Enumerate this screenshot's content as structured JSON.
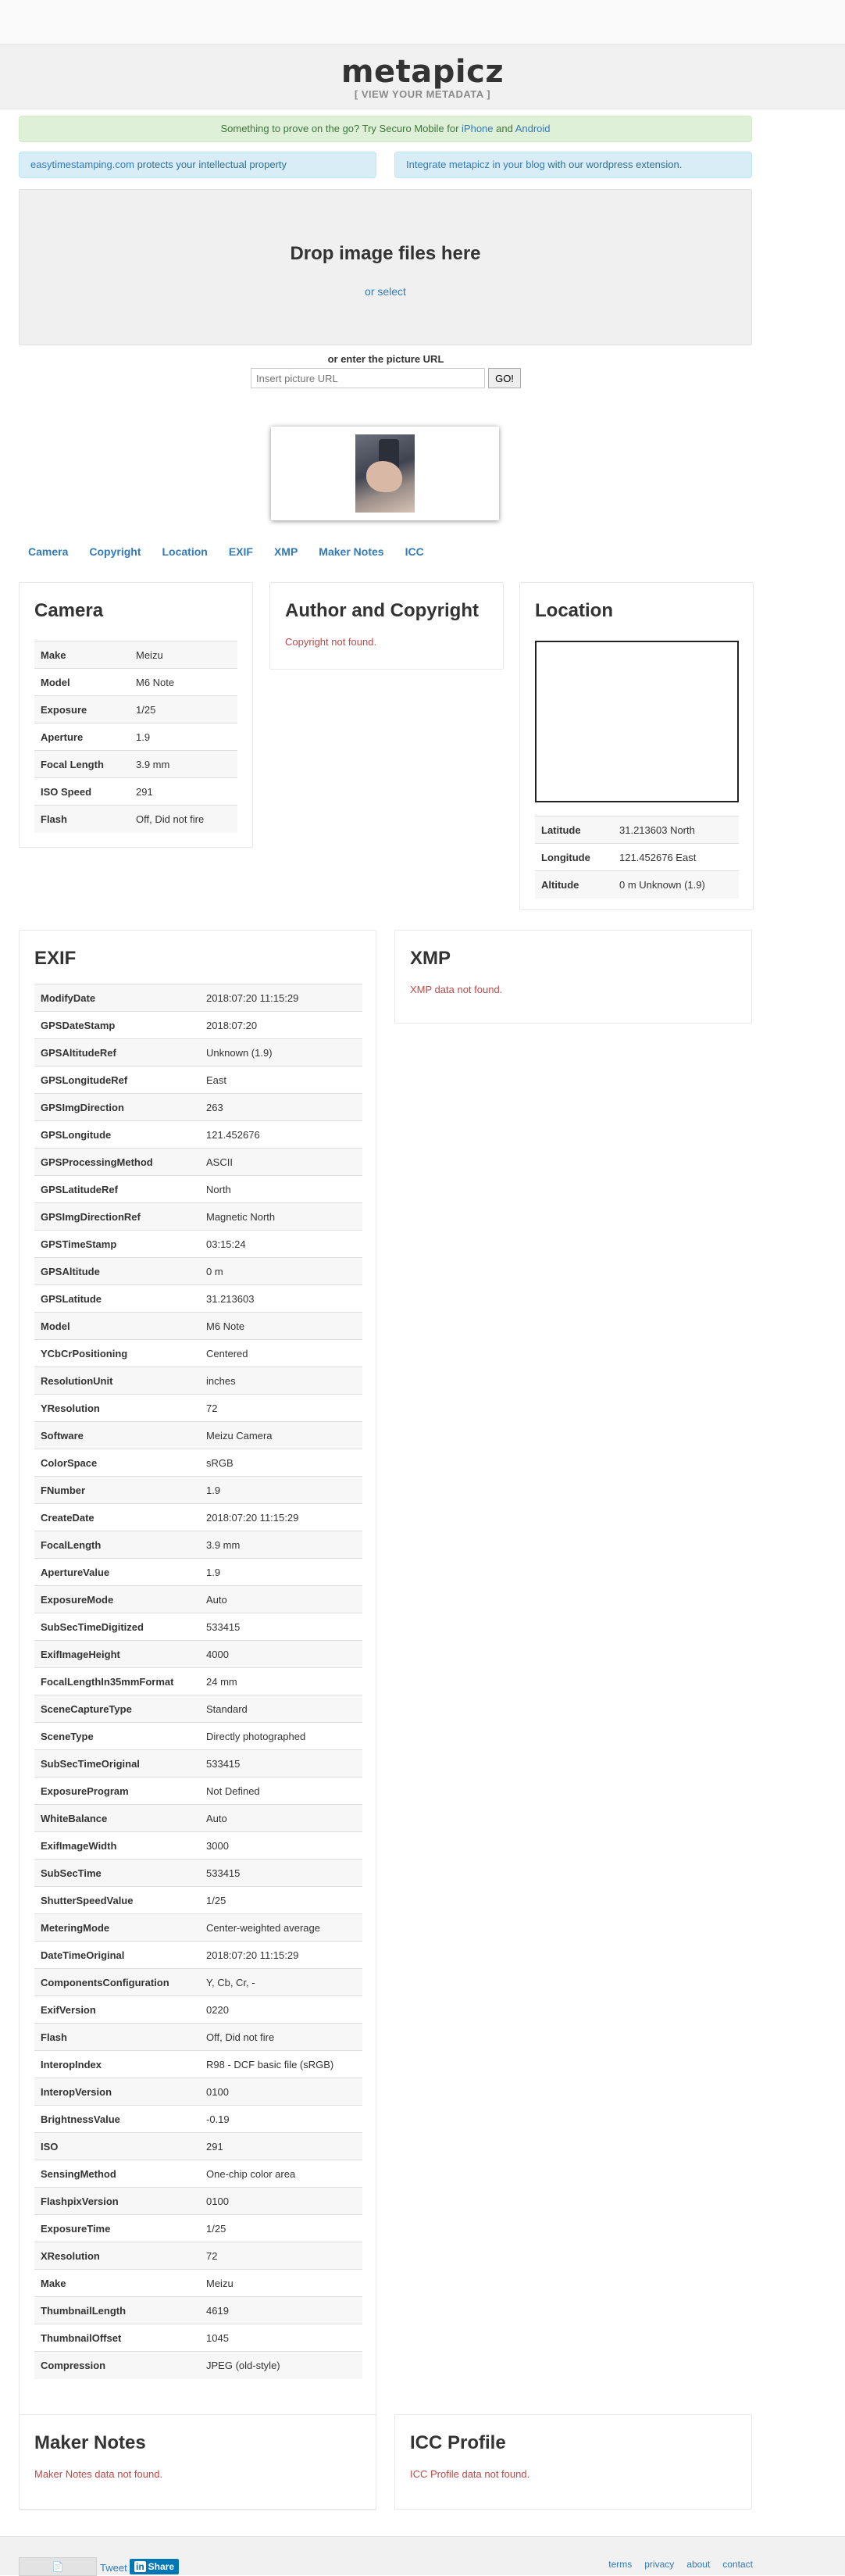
{
  "header": {
    "logo": "metapicz",
    "tagline": "[ VIEW YOUR METADATA ]"
  },
  "alerts": {
    "mobile": {
      "prefix": "Something to prove on the go? Try Securo Mobile for ",
      "iphone": "iPhone",
      "and": " and ",
      "android": "Android"
    },
    "stamping": {
      "link": "easytimestamping.com",
      "text": " protects your intellectual property"
    },
    "wordpress": {
      "link": "Integrate metapicz in your blog",
      "text": " with our wordpress extension."
    }
  },
  "dropzone": {
    "title": "Drop image files here",
    "select": "or select"
  },
  "url": {
    "label": "or enter the picture URL",
    "placeholder": "Insert picture URL",
    "go": "GO!"
  },
  "tabs": [
    "Camera",
    "Copyright",
    "Location",
    "EXIF",
    "XMP",
    "Maker Notes",
    "ICC"
  ],
  "camera": {
    "title": "Camera",
    "rows": [
      [
        "Make",
        "Meizu"
      ],
      [
        "Model",
        "M6 Note"
      ],
      [
        "Exposure",
        "1/25"
      ],
      [
        "Aperture",
        "1.9"
      ],
      [
        "Focal Length",
        "3.9 mm"
      ],
      [
        "ISO Speed",
        "291"
      ],
      [
        "Flash",
        "Off, Did not fire"
      ]
    ]
  },
  "copyright": {
    "title": "Author and Copyright",
    "empty": "Copyright not found."
  },
  "location": {
    "title": "Location",
    "rows": [
      [
        "Latitude",
        "31.213603 North"
      ],
      [
        "Longitude",
        "121.452676 East"
      ],
      [
        "Altitude",
        "0 m Unknown (1.9)"
      ]
    ]
  },
  "exif": {
    "title": "EXIF",
    "rows": [
      [
        "ModifyDate",
        "2018:07:20 11:15:29"
      ],
      [
        "GPSDateStamp",
        "2018:07:20"
      ],
      [
        "GPSAltitudeRef",
        "Unknown (1.9)"
      ],
      [
        "GPSLongitudeRef",
        "East"
      ],
      [
        "GPSImgDirection",
        "263"
      ],
      [
        "GPSLongitude",
        "121.452676"
      ],
      [
        "GPSProcessingMethod",
        "ASCII"
      ],
      [
        "GPSLatitudeRef",
        "North"
      ],
      [
        "GPSImgDirectionRef",
        "Magnetic North"
      ],
      [
        "GPSTimeStamp",
        "03:15:24"
      ],
      [
        "GPSAltitude",
        "0 m"
      ],
      [
        "GPSLatitude",
        "31.213603"
      ],
      [
        "Model",
        "M6 Note"
      ],
      [
        "YCbCrPositioning",
        "Centered"
      ],
      [
        "ResolutionUnit",
        "inches"
      ],
      [
        "YResolution",
        "72"
      ],
      [
        "Software",
        "Meizu Camera"
      ],
      [
        "ColorSpace",
        "sRGB"
      ],
      [
        "FNumber",
        "1.9"
      ],
      [
        "CreateDate",
        "2018:07:20 11:15:29"
      ],
      [
        "FocalLength",
        "3.9 mm"
      ],
      [
        "ApertureValue",
        "1.9"
      ],
      [
        "ExposureMode",
        "Auto"
      ],
      [
        "SubSecTimeDigitized",
        "533415"
      ],
      [
        "ExifImageHeight",
        "4000"
      ],
      [
        "FocalLengthIn35mmFormat",
        "24 mm"
      ],
      [
        "SceneCaptureType",
        "Standard"
      ],
      [
        "SceneType",
        "Directly photographed"
      ],
      [
        "SubSecTimeOriginal",
        "533415"
      ],
      [
        "ExposureProgram",
        "Not Defined"
      ],
      [
        "WhiteBalance",
        "Auto"
      ],
      [
        "ExifImageWidth",
        "3000"
      ],
      [
        "SubSecTime",
        "533415"
      ],
      [
        "ShutterSpeedValue",
        "1/25"
      ],
      [
        "MeteringMode",
        "Center-weighted average"
      ],
      [
        "DateTimeOriginal",
        "2018:07:20 11:15:29"
      ],
      [
        "ComponentsConfiguration",
        "Y, Cb, Cr, -"
      ],
      [
        "ExifVersion",
        "0220"
      ],
      [
        "Flash",
        "Off, Did not fire"
      ],
      [
        "InteropIndex",
        "R98 - DCF basic file (sRGB)"
      ],
      [
        "InteropVersion",
        "0100"
      ],
      [
        "BrightnessValue",
        "-0.19"
      ],
      [
        "ISO",
        "291"
      ],
      [
        "SensingMethod",
        "One-chip color area"
      ],
      [
        "FlashpixVersion",
        "0100"
      ],
      [
        "ExposureTime",
        "1/25"
      ],
      [
        "XResolution",
        "72"
      ],
      [
        "Make",
        "Meizu"
      ],
      [
        "ThumbnailLength",
        "4619"
      ],
      [
        "ThumbnailOffset",
        "1045"
      ],
      [
        "Compression",
        "JPEG (old-style)"
      ]
    ]
  },
  "xmp": {
    "title": "XMP",
    "empty": "XMP data not found."
  },
  "maker": {
    "title": "Maker Notes",
    "empty": "Maker Notes data not found."
  },
  "icc": {
    "title": "ICC Profile",
    "empty": "ICC Profile data not found."
  },
  "footer": {
    "tweet": "Tweet",
    "share": "Share",
    "links": [
      "terms",
      "privacy",
      "about",
      "contact"
    ]
  }
}
